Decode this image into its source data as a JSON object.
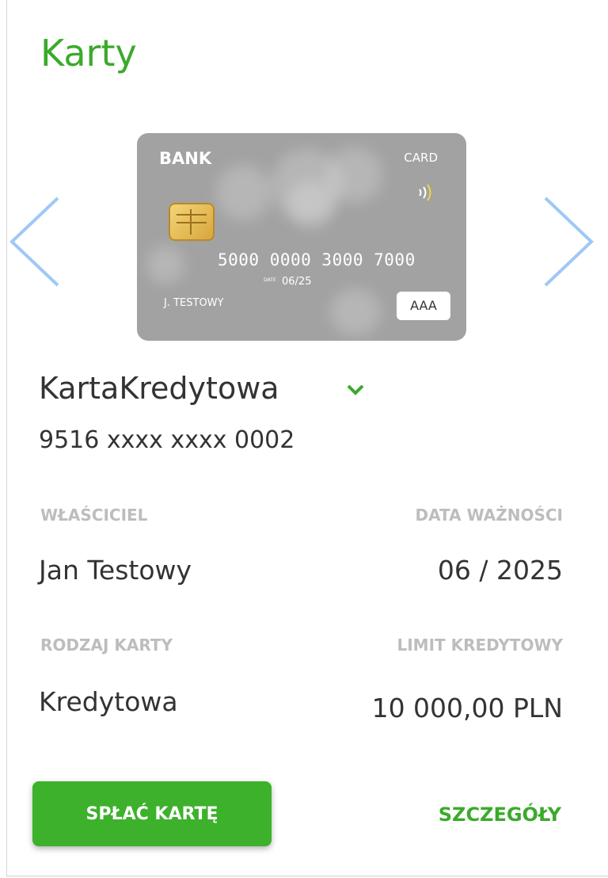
{
  "header": {
    "title": "Karty"
  },
  "card_visual": {
    "bank_label": "BANK",
    "type_label": "CARD",
    "number": "5000 0000 3000 7000",
    "date_label": "DATE",
    "date": "06/25",
    "holder": "J. TESTOWY",
    "badge": "AAA",
    "color": "#a2a2a2"
  },
  "card": {
    "name": "KartaKredytowa",
    "masked_number": "9516 xxxx xxxx 0002"
  },
  "details": {
    "owner_label": "WŁAŚCICIEL",
    "owner_value": "Jan Testowy",
    "expiry_label": "DATA WAŻNOŚCI",
    "expiry_value": "06 / 2025",
    "type_label": "RODZAJ KARTY",
    "type_value": "Kredytowa",
    "limit_label": "LIMIT KREDYTOWY",
    "limit_value": "10 000,00 PLN"
  },
  "actions": {
    "pay_label": "SPŁAĆ KARTĘ",
    "details_label": "SZCZEGÓŁY"
  },
  "colors": {
    "accent": "#3aaa2a",
    "button": "#3db12b",
    "arrow": "#9fc8f6",
    "label": "#bdbdbd"
  },
  "icons": {
    "prev": "chevron-left-icon",
    "next": "chevron-right-icon",
    "dropdown": "chevron-down-icon",
    "contactless": "contactless-icon",
    "chip": "chip-icon"
  }
}
